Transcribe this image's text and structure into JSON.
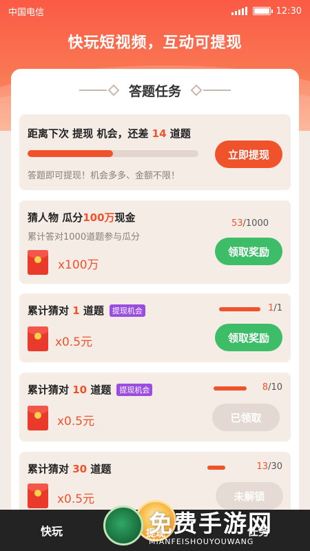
{
  "status_bar": {
    "carrier": "中国电信",
    "time": "12:30"
  },
  "headline": "快玩短视频，互动可提现",
  "panel": {
    "title": "答题任务",
    "withdraw_card": {
      "prefix": "距离下次 提现 机会，还差 ",
      "remaining": "14",
      "suffix": " 道题",
      "progress": 0.5,
      "hint": "答题即可提现！机会多多、金额不限！",
      "button": "立即提现"
    },
    "tasks": [
      {
        "title_prefix": "猜人物 瓜分",
        "title_highlight": "100万",
        "title_suffix": "现金",
        "desc": "累计答对1000道题参与瓜分",
        "reward": "x100万",
        "count_done": "53",
        "count_total": "/1000",
        "button": "领取奖励"
      },
      {
        "title_prefix": "累计猜对 ",
        "title_highlight": "1",
        "title_suffix": " 道题",
        "tag": "提现机会",
        "reward": "x0.5元",
        "count_done": "1",
        "count_total": "/1",
        "progress": 1.0,
        "button": "领取奖励"
      },
      {
        "title_prefix": "累计猜对 ",
        "title_highlight": "10",
        "title_suffix": " 道题",
        "tag": "提现机会",
        "reward": "x0.5元",
        "count_done": "8",
        "count_total": "/10",
        "progress": 0.8,
        "button": "已领取"
      },
      {
        "title_prefix": "累计猜对 ",
        "title_highlight": "30",
        "title_suffix": " 道题",
        "reward": "x0.5元",
        "count_done": "13",
        "count_total": "/30",
        "progress": 0.43,
        "button": "未解锁"
      }
    ]
  },
  "bottom_nav": {
    "left": "快玩",
    "center": "提现",
    "right": "任务"
  },
  "watermark": {
    "big": "免费手游网",
    "small": "MIANFEISHOUYOUWANG"
  },
  "colors": {
    "accent": "#f0532c",
    "green": "#3dbd68",
    "tag": "#9a4de0"
  }
}
